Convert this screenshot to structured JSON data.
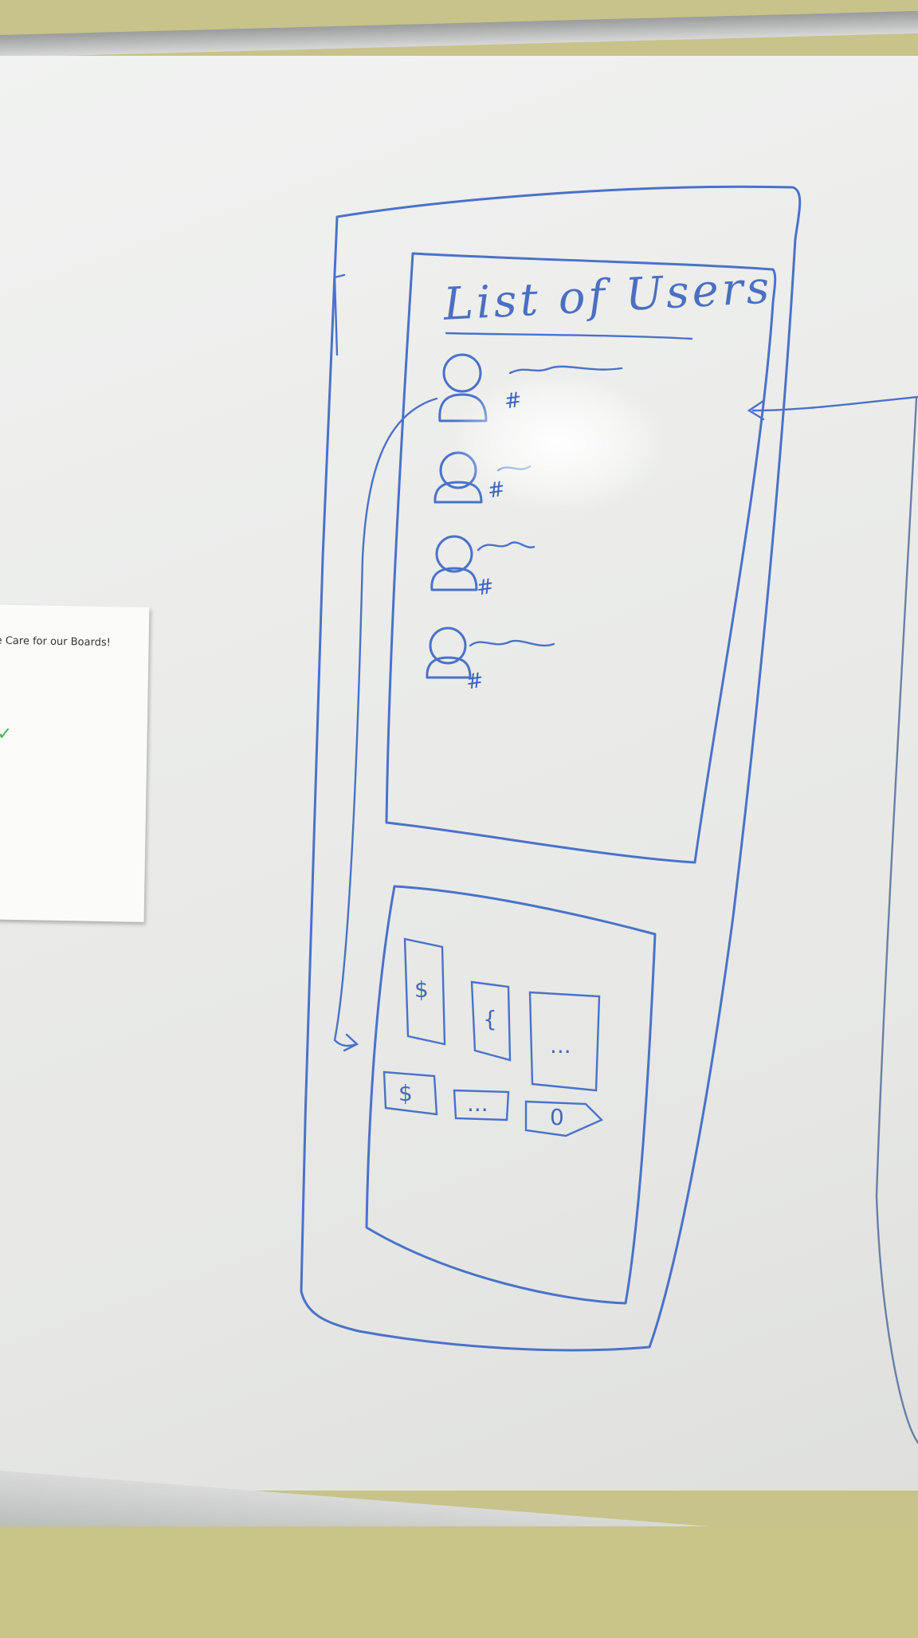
{
  "sketch": {
    "heading": "List of Users",
    "users": [
      {
        "avatar": "user-icon",
        "badge": "#"
      },
      {
        "avatar": "user-icon",
        "badge": "#"
      },
      {
        "avatar": "user-icon",
        "badge": "#"
      },
      {
        "avatar": "user-icon",
        "badge": "#"
      }
    ],
    "grid": {
      "tiles_row1": [
        "$",
        "{",
        "..."
      ],
      "tiles_row2": [
        "$",
        "...",
        "0"
      ]
    }
  },
  "notice": {
    "title": "e Care for our Boards!",
    "check_icon": "check-icon"
  },
  "colors": {
    "ink": "#4a72c9",
    "board": "#ecedeb",
    "wall": "#c7c38a"
  }
}
